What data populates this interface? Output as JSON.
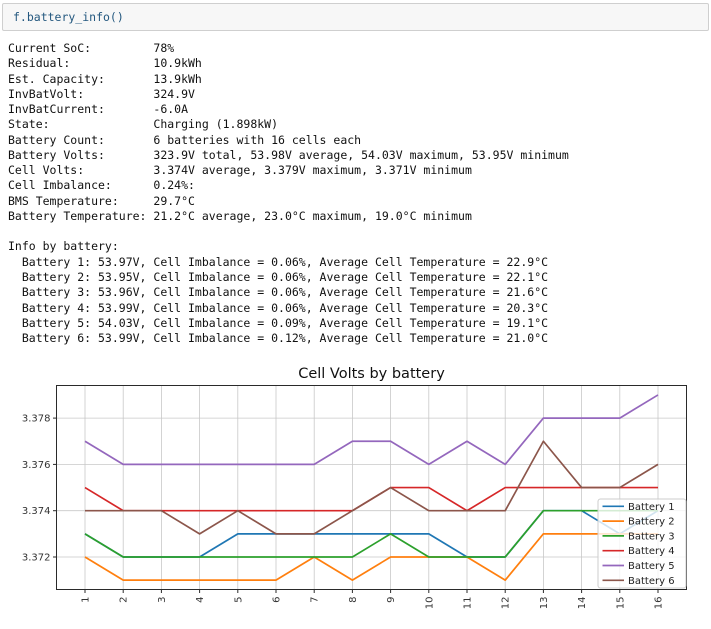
{
  "code_cell": {
    "code": "f.battery_info()"
  },
  "output": {
    "lines": [
      "Current SoC:         78%",
      "Residual:            10.9kWh",
      "Est. Capacity:       13.9kWh",
      "InvBatVolt:          324.9V",
      "InvBatCurrent:       -6.0A",
      "State:               Charging (1.898kW)",
      "Battery Count:       6 batteries with 16 cells each",
      "Battery Volts:       323.9V total, 53.98V average, 54.03V maximum, 53.95V minimum",
      "Cell Volts:          3.374V average, 3.379V maximum, 3.371V minimum",
      "Cell Imbalance:      0.24%:",
      "BMS Temperature:     29.7°C",
      "Battery Temperature: 21.2°C average, 23.0°C maximum, 19.0°C minimum",
      "",
      "Info by battery:",
      "  Battery 1: 53.97V, Cell Imbalance = 0.06%, Average Cell Temperature = 22.9°C",
      "  Battery 2: 53.95V, Cell Imbalance = 0.06%, Average Cell Temperature = 22.1°C",
      "  Battery 3: 53.96V, Cell Imbalance = 0.06%, Average Cell Temperature = 21.6°C",
      "  Battery 4: 53.99V, Cell Imbalance = 0.06%, Average Cell Temperature = 20.3°C",
      "  Battery 5: 54.03V, Cell Imbalance = 0.09%, Average Cell Temperature = 19.1°C",
      "  Battery 6: 53.99V, Cell Imbalance = 0.12%, Average Cell Temperature = 21.0°C"
    ]
  },
  "chart_data": {
    "type": "line",
    "title": "Cell Volts by battery",
    "x": [
      1,
      2,
      3,
      4,
      5,
      6,
      7,
      8,
      9,
      10,
      11,
      12,
      13,
      14,
      15,
      16
    ],
    "xticklabels": [
      "1",
      "2",
      "3",
      "4",
      "5",
      "6",
      "7",
      "8",
      "9",
      "10",
      "11",
      "12",
      "13",
      "14",
      "15",
      "16"
    ],
    "yticks": [
      3.372,
      3.374,
      3.376,
      3.378
    ],
    "ylim": [
      3.3703,
      3.3794
    ],
    "grid": true,
    "legend_position": "center right",
    "series": [
      {
        "name": "Battery 1",
        "color": "#1f77b4",
        "values": [
          3.373,
          3.372,
          3.372,
          3.372,
          3.373,
          3.373,
          3.373,
          3.373,
          3.373,
          3.373,
          3.372,
          3.372,
          3.374,
          3.374,
          3.373,
          3.374
        ]
      },
      {
        "name": "Battery 2",
        "color": "#ff7f0e",
        "values": [
          3.372,
          3.371,
          3.371,
          3.371,
          3.371,
          3.371,
          3.372,
          3.371,
          3.372,
          3.372,
          3.372,
          3.371,
          3.373,
          3.373,
          3.373,
          3.373
        ]
      },
      {
        "name": "Battery 3",
        "color": "#2ca02c",
        "values": [
          3.373,
          3.372,
          3.372,
          3.372,
          3.372,
          3.372,
          3.372,
          3.372,
          3.373,
          3.372,
          3.372,
          3.372,
          3.374,
          3.374,
          3.374,
          3.374
        ]
      },
      {
        "name": "Battery 4",
        "color": "#d62728",
        "values": [
          3.375,
          3.374,
          3.374,
          3.374,
          3.374,
          3.374,
          3.374,
          3.374,
          3.375,
          3.375,
          3.374,
          3.375,
          3.375,
          3.375,
          3.375,
          3.375
        ]
      },
      {
        "name": "Battery 5",
        "color": "#9467bd",
        "values": [
          3.377,
          3.376,
          3.376,
          3.376,
          3.376,
          3.376,
          3.376,
          3.377,
          3.377,
          3.376,
          3.377,
          3.376,
          3.378,
          3.378,
          3.378,
          3.379
        ]
      },
      {
        "name": "Battery 6",
        "color": "#8c564b",
        "values": [
          3.374,
          3.374,
          3.374,
          3.373,
          3.374,
          3.373,
          3.373,
          3.374,
          3.375,
          3.374,
          3.374,
          3.374,
          3.377,
          3.375,
          3.375,
          3.376
        ]
      }
    ]
  }
}
